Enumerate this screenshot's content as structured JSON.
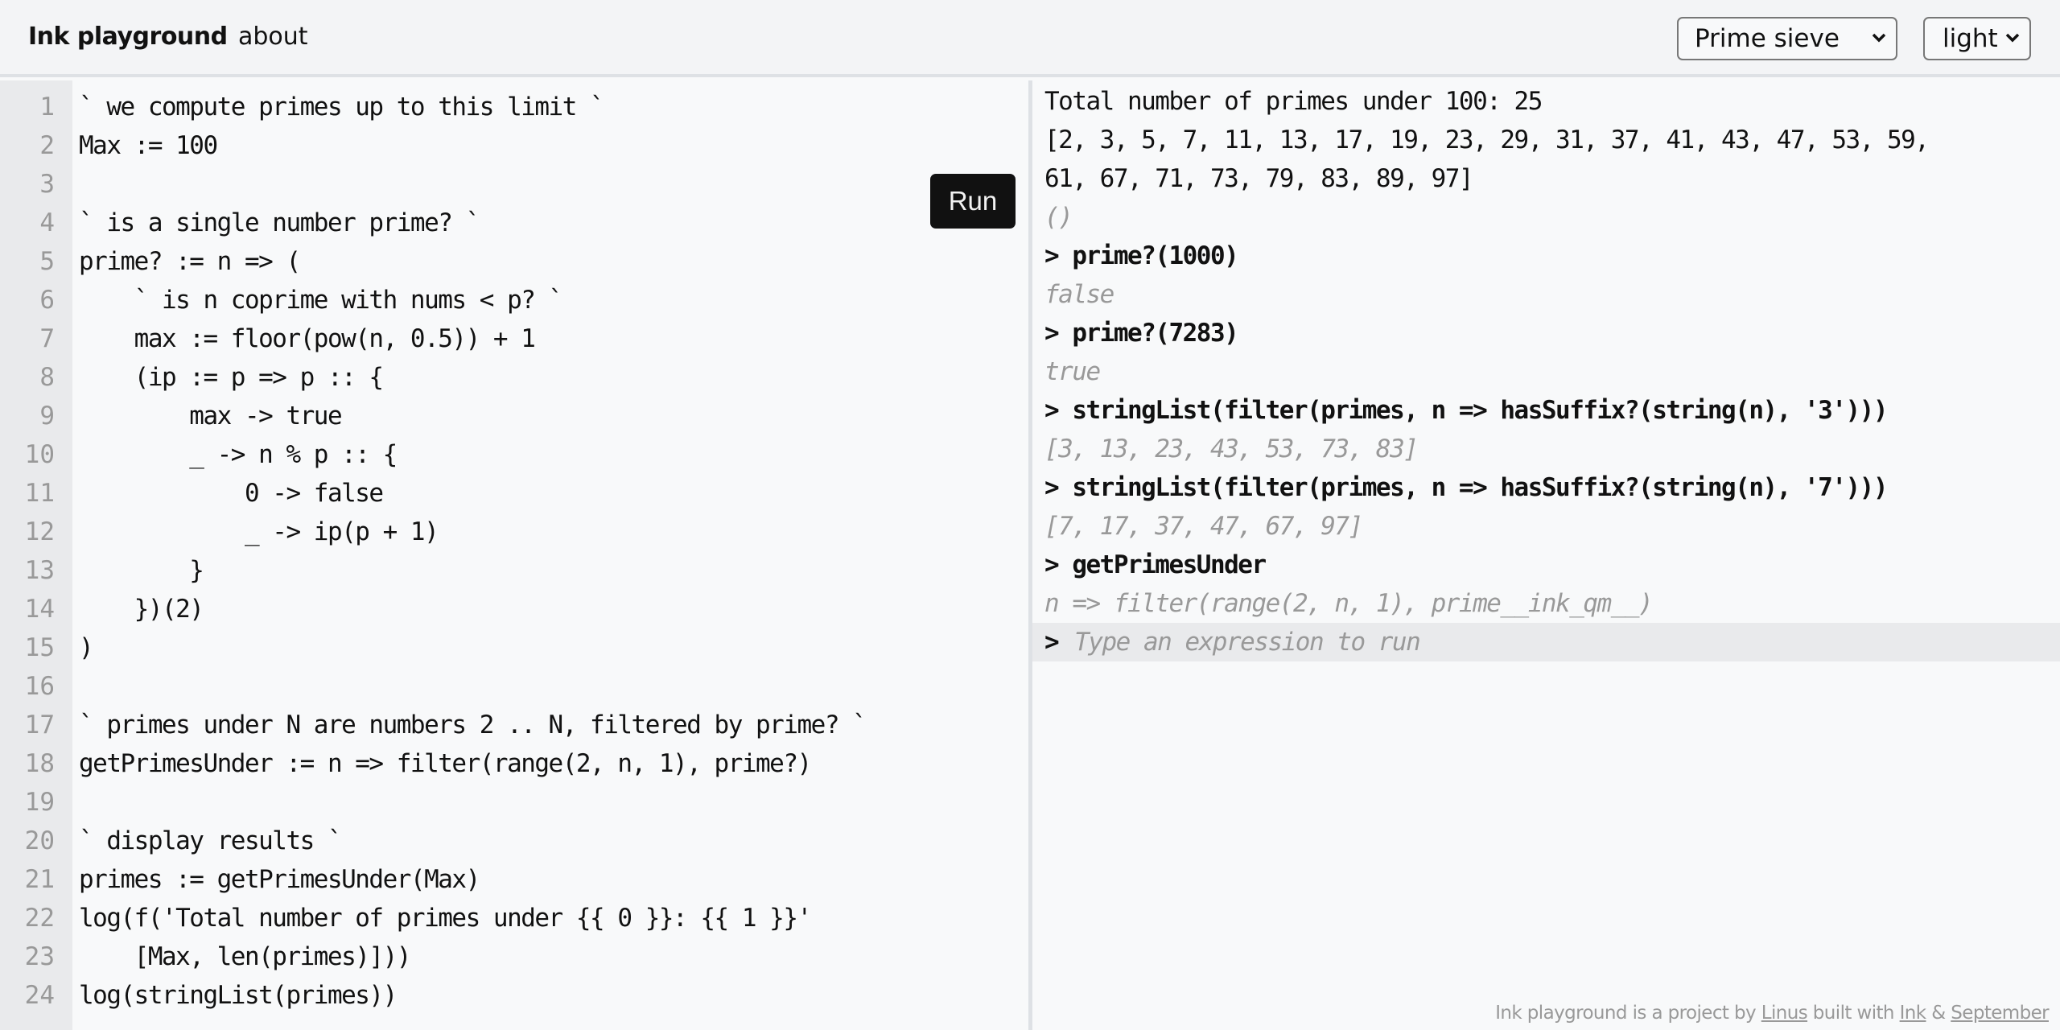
{
  "header": {
    "title": "Ink playground",
    "about_link": "about",
    "example_select": {
      "selected": "Prime sieve",
      "icon": "chevron-down-icon"
    },
    "theme_select": {
      "selected": "light",
      "icon": "chevron-down-icon"
    }
  },
  "editor": {
    "run_label": "Run",
    "lines": [
      {
        "n": "1",
        "text": "` we compute primes up to this limit `"
      },
      {
        "n": "2",
        "text": "Max := 100"
      },
      {
        "n": "3",
        "text": ""
      },
      {
        "n": "4",
        "text": "` is a single number prime? `"
      },
      {
        "n": "5",
        "text": "prime? := n => ("
      },
      {
        "n": "6",
        "text": "    ` is n coprime with nums < p? `"
      },
      {
        "n": "7",
        "text": "    max := floor(pow(n, 0.5)) + 1"
      },
      {
        "n": "8",
        "text": "    (ip := p => p :: {"
      },
      {
        "n": "9",
        "text": "        max -> true"
      },
      {
        "n": "10",
        "text": "        _ -> n % p :: {"
      },
      {
        "n": "11",
        "text": "            0 -> false"
      },
      {
        "n": "12",
        "text": "            _ -> ip(p + 1)"
      },
      {
        "n": "13",
        "text": "        }"
      },
      {
        "n": "14",
        "text": "    })(2)"
      },
      {
        "n": "15",
        "text": ")"
      },
      {
        "n": "16",
        "text": ""
      },
      {
        "n": "17",
        "text": "` primes under N are numbers 2 .. N, filtered by prime? `"
      },
      {
        "n": "18",
        "text": "getPrimesUnder := n => filter(range(2, n, 1), prime?)"
      },
      {
        "n": "19",
        "text": ""
      },
      {
        "n": "20",
        "text": "` display results `"
      },
      {
        "n": "21",
        "text": "primes := getPrimesUnder(Max)"
      },
      {
        "n": "22",
        "text": "log(f('Total number of primes under {{ 0 }}: {{ 1 }}'"
      },
      {
        "n": "23",
        "text": "    [Max, len(primes)]))"
      },
      {
        "n": "24",
        "text": "log(stringList(primes))"
      }
    ]
  },
  "repl": {
    "entries": [
      {
        "kind": "log",
        "text": "Total number of primes under 100: 25"
      },
      {
        "kind": "log",
        "text": "[2, 3, 5, 7, 11, 13, 17, 19, 23, 29, 31, 37, 41, 43, 47, 53, 59,"
      },
      {
        "kind": "log",
        "text": "61, 67, 71, 73, 79, 83, 89, 97]"
      },
      {
        "kind": "result",
        "text": "()"
      },
      {
        "kind": "cmd",
        "text": "> prime?(1000)"
      },
      {
        "kind": "result",
        "text": "false"
      },
      {
        "kind": "cmd",
        "text": "> prime?(7283)"
      },
      {
        "kind": "result",
        "text": "true"
      },
      {
        "kind": "cmd",
        "text": "> stringList(filter(primes, n => hasSuffix?(string(n), '3')))"
      },
      {
        "kind": "result",
        "text": "[3, 13, 23, 43, 53, 73, 83]"
      },
      {
        "kind": "cmd",
        "text": "> stringList(filter(primes, n => hasSuffix?(string(n), '7')))"
      },
      {
        "kind": "result",
        "text": "[7, 17, 37, 47, 67, 97]"
      },
      {
        "kind": "cmd",
        "text": "> getPrimesUnder"
      },
      {
        "kind": "result",
        "text": "n => filter(range(2, n, 1), prime__ink_qm__)"
      }
    ],
    "prompt": ">",
    "input_value": "",
    "input_placeholder": "Type an expression to run"
  },
  "footer": {
    "prefix": "Ink playground is a project by ",
    "link_author": "Linus",
    "middle": " built with ",
    "link_ink": "Ink",
    "amp": " & ",
    "link_september": "September"
  }
}
